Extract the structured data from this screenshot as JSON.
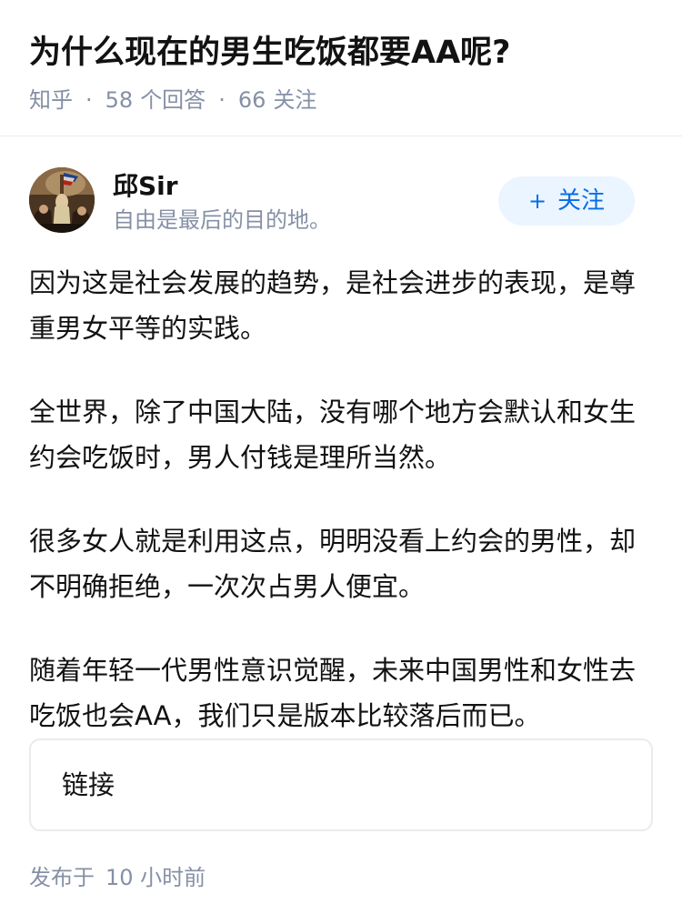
{
  "question": {
    "title": "为什么现在的男生吃饭都要AA呢?",
    "source": "知乎",
    "answer_count": "58",
    "answer_label": "个回答",
    "follower_count": "66",
    "follower_label": "关注"
  },
  "author": {
    "name": "邱Sir",
    "bio": "自由是最后的目的地。",
    "avatar_icon": "painting-avatar-icon",
    "follow_plus": "+",
    "follow_label": "关注"
  },
  "answer": {
    "paragraphs": [
      "因为这是社会发展的趋势，是社会进步的表现，是尊重男女平等的实践。",
      "全世界，除了中国大陆，没有哪个地方会默认和女生约会吃饭时，男人付钱是理所当然。",
      "很多女人就是利用这点，明明没看上约会的男性，却不明确拒绝，一次次占男人便宜。",
      "随着年轻一代男性意识觉醒，未来中国男性和女性去吃饭也会AA，我们只是版本比较落后而已。"
    ]
  },
  "link_card": {
    "label": "链接"
  },
  "footer": {
    "published_prefix": "发布于",
    "published_time": "10 小时前"
  },
  "colors": {
    "accent": "#056de8",
    "follow_bg": "#ebf5ff",
    "meta_text": "#8590a6",
    "body_text": "#121212",
    "divider": "#ebebeb"
  }
}
